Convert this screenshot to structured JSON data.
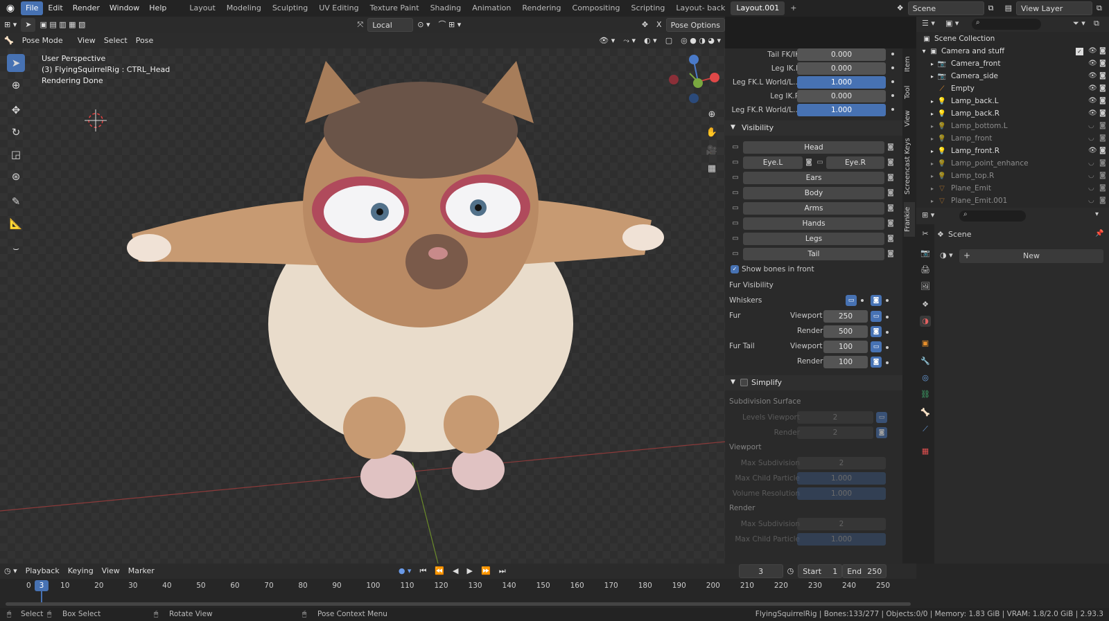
{
  "menubar": {
    "menus": [
      "File",
      "Edit",
      "Render",
      "Window",
      "Help"
    ],
    "workspaces": [
      "Layout",
      "Modeling",
      "Sculpting",
      "UV Editing",
      "Texture Paint",
      "Shading",
      "Animation",
      "Rendering",
      "Compositing",
      "Scripting",
      "Layout- back",
      "Layout.001"
    ],
    "scene": "Scene",
    "view_layer": "View Layer"
  },
  "viewport_header": {
    "orientation": "Local",
    "pose_options": "Pose Options",
    "mode": "Pose Mode",
    "menus": [
      "View",
      "Select",
      "Pose"
    ]
  },
  "viewport": {
    "perspective": "User Perspective",
    "object_info": "(3) FlyingSquirrelRig : CTRL_Head",
    "render_status": "Rendering Done"
  },
  "npanel": {
    "props": [
      {
        "label": "Tail FK/IK",
        "value": "0.000",
        "blue": false
      },
      {
        "label": "Leg IK.L",
        "value": "0.000",
        "blue": false
      },
      {
        "label": "Leg FK.L World/L...",
        "value": "1.000",
        "blue": true
      },
      {
        "label": "Leg IK.R",
        "value": "0.000",
        "blue": false
      },
      {
        "label": "Leg FK.R World/L...",
        "value": "1.000",
        "blue": true
      }
    ],
    "visibility_title": "Visibility",
    "visibility_buttons": [
      "Head",
      "Ears",
      "Body",
      "Arms",
      "Hands",
      "Legs",
      "Tail"
    ],
    "eye_l": "Eye.L",
    "eye_r": "Eye.R",
    "show_bones": "Show bones in front",
    "fur_visibility": "Fur Visibility",
    "whiskers": "Whiskers",
    "fur": "Fur",
    "fur_tail": "Fur Tail",
    "viewport_label": "Viewport",
    "render_label": "Render",
    "fur_viewport": "250",
    "fur_render": "500",
    "furtail_viewport": "100",
    "furtail_render": "100",
    "simplify_title": "Simplify",
    "subdiv_surface": "Subdivision Surface",
    "levels_viewport": "Levels Viewport",
    "levels_viewport_val": "2",
    "render_val": "2",
    "viewport_section": "Viewport",
    "max_subdivision": "Max Subdivision",
    "max_subdiv_val": "2",
    "max_child_particle": "Max Child Particle",
    "max_child_val": "1.000",
    "volume_resolution": "Volume Resolution",
    "volume_val": "1.000",
    "render_section": "Render",
    "render_max_subdiv_val": "2",
    "render_max_child_val": "1.000"
  },
  "sidetabs": [
    "Item",
    "Tool",
    "View",
    "Screencast Keys",
    "Frankie"
  ],
  "outliner": {
    "root": "Scene Collection",
    "collection": "Camera and stuff",
    "items": [
      {
        "name": "Camera_front",
        "type": "camera",
        "dim": false
      },
      {
        "name": "Camera_side",
        "type": "camera",
        "dim": false
      },
      {
        "name": "Empty",
        "type": "empty",
        "dim": false
      },
      {
        "name": "Lamp_back.L",
        "type": "lamp",
        "dim": false
      },
      {
        "name": "Lamp_back.R",
        "type": "lamp",
        "dim": false
      },
      {
        "name": "Lamp_bottom.L",
        "type": "lamp",
        "dim": true
      },
      {
        "name": "Lamp_front",
        "type": "lamp",
        "dim": true
      },
      {
        "name": "Lamp_front.R",
        "type": "lamp",
        "dim": false
      },
      {
        "name": "Lamp_point_enhance",
        "type": "lamp",
        "dim": true
      },
      {
        "name": "Lamp_top.R",
        "type": "lamp",
        "dim": true
      },
      {
        "name": "Plane_Emit",
        "type": "mesh",
        "dim": true
      },
      {
        "name": "Plane_Emit.001",
        "type": "mesh",
        "dim": true
      }
    ]
  },
  "properties": {
    "scene": "Scene",
    "new_button": "New"
  },
  "timeline": {
    "menus": [
      "Playback",
      "Keying",
      "View",
      "Marker"
    ],
    "current_frame": "3",
    "start_label": "Start",
    "start": "1",
    "end_label": "End",
    "end": "250",
    "ticks": [
      "0",
      "10",
      "20",
      "30",
      "40",
      "50",
      "60",
      "70",
      "80",
      "90",
      "100",
      "110",
      "120",
      "130",
      "140",
      "150",
      "160",
      "170",
      "180",
      "190",
      "200",
      "210",
      "220",
      "230",
      "240",
      "250"
    ]
  },
  "statusbar": {
    "select": "Select",
    "box_select": "Box Select",
    "rotate_view": "Rotate View",
    "context_menu": "Pose Context Menu",
    "stats": "FlyingSquirrelRig | Bones:133/277 | Objects:0/0 | Memory: 1.83 GiB | VRAM: 1.8/2.0 GiB | 2.93.3"
  },
  "colors": {
    "accent": "#4772b3",
    "bg": "#1d1d1d",
    "panel": "#2a2a2a"
  }
}
